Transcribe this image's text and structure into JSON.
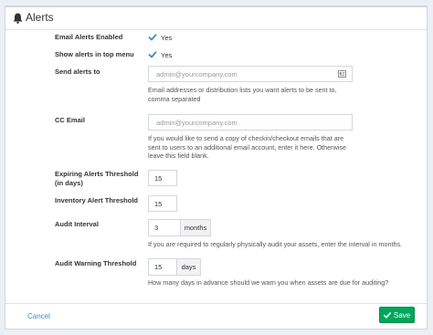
{
  "header": {
    "title": "Alerts"
  },
  "fields": {
    "email_alerts": {
      "label": "Email Alerts Enabled",
      "option": "Yes",
      "checked": true
    },
    "top_menu": {
      "label": "Show alerts in top menu",
      "option": "Yes",
      "checked": true
    },
    "send_alerts": {
      "label": "Send alerts to",
      "placeholder": "admin@yourcompany.com",
      "help_line1": "Email addresses or distribution lists you want alerts to be sent to,",
      "help_line2": "comma separated"
    },
    "cc_email": {
      "label": "CC Email",
      "placeholder": "admin@yourcompany.com",
      "help_line1": "If you would like to send a copy of checkin/checkout emails that are",
      "help_line2": "sent to users to an additional email account, enter it here. Otherwise",
      "help_line3": "leave this field blank."
    },
    "expiring": {
      "label_line1": "Expiring Alerts Threshold",
      "label_line2": "(in days)",
      "value": "15"
    },
    "inventory": {
      "label": "Inventory Alert Threshold",
      "value": "15"
    },
    "audit_interval": {
      "label": "Audit Interval",
      "value": "3",
      "unit": "months",
      "help": "If you are required to regularly physically audit your assets, enter the interval in months."
    },
    "audit_warning": {
      "label": "Audit Warning Threshold",
      "value": "15",
      "unit": "days",
      "help": "How many days in advance should we warn you when assets are due for auditing?"
    }
  },
  "footer": {
    "cancel_label": "Cancel",
    "save_label": "Save"
  },
  "icons": {
    "header": "bell-icon",
    "checkbox": "checkmark-icon",
    "contact": "address-card-icon",
    "save": "check-icon"
  },
  "colors": {
    "accent": "#3c8dbc",
    "save": "#00a65a",
    "check": "#3c8dbc"
  }
}
